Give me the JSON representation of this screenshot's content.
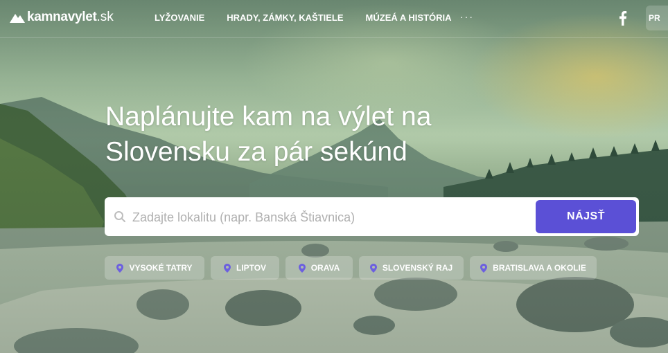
{
  "brand": {
    "name": "kamnavylet",
    "tld": ".sk"
  },
  "nav": {
    "items": [
      {
        "label": "LYŽOVANIE"
      },
      {
        "label": "HRADY, ZÁMKY, KAŠTIELE"
      },
      {
        "label": "MÚZEÁ A HISTÓRIA"
      }
    ],
    "more_label": "···",
    "partial_button_label": "PR"
  },
  "hero": {
    "headline_line1": "Naplánujte kam na výlet na",
    "headline_line2": "Slovensku za pár sekúnd"
  },
  "search": {
    "placeholder": "Zadajte lokalitu (napr. Banská Štiavnica)",
    "value": "",
    "button_label": "NÁJSŤ"
  },
  "chips": [
    {
      "label": "VYSOKÉ TATRY"
    },
    {
      "label": "LIPTOV"
    },
    {
      "label": "ORAVA"
    },
    {
      "label": "SLOVENSKÝ RAJ"
    },
    {
      "label": "BRATISLAVA A OKOLIE"
    }
  ],
  "colors": {
    "accent": "#5b50d6",
    "pin": "#6c5fe0",
    "text_on_dark": "#ffffff"
  },
  "icons": {
    "logo": "mountain-icon",
    "search": "search-icon",
    "facebook": "facebook-icon",
    "chip": "map-pin-icon"
  }
}
